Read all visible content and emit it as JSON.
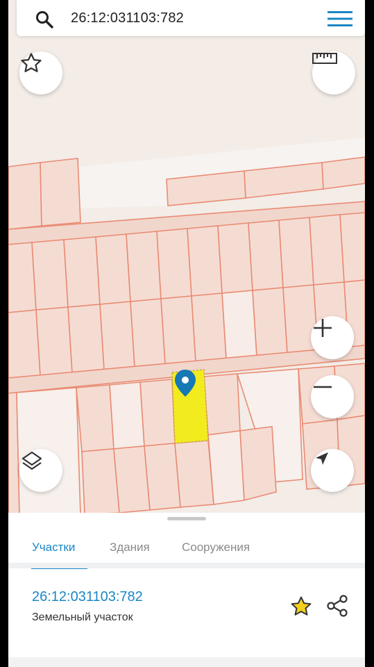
{
  "search": {
    "query": "26:12:031103:782"
  },
  "panel": {
    "tabs": [
      {
        "label": "Участки"
      },
      {
        "label": "Здания"
      },
      {
        "label": "Сооружения"
      }
    ],
    "parcel": {
      "number": "26:12:031103:782",
      "type": "Земельный участок"
    }
  },
  "colors": {
    "accent": "#1a86c4",
    "parcel_highlight": "#f2ec1f",
    "parcel_border": "#e98b73",
    "marker": "#1678b4",
    "favorite_star": "#f3d01b"
  },
  "icons": {
    "search": "search-icon",
    "menu": "menu-icon",
    "favorite": "star-icon",
    "ruler": "ruler-icon",
    "zoom_in": "plus-icon",
    "zoom_out": "minus-icon",
    "layers": "layers-icon",
    "locate": "navigation-arrow-icon",
    "share": "share-icon"
  }
}
